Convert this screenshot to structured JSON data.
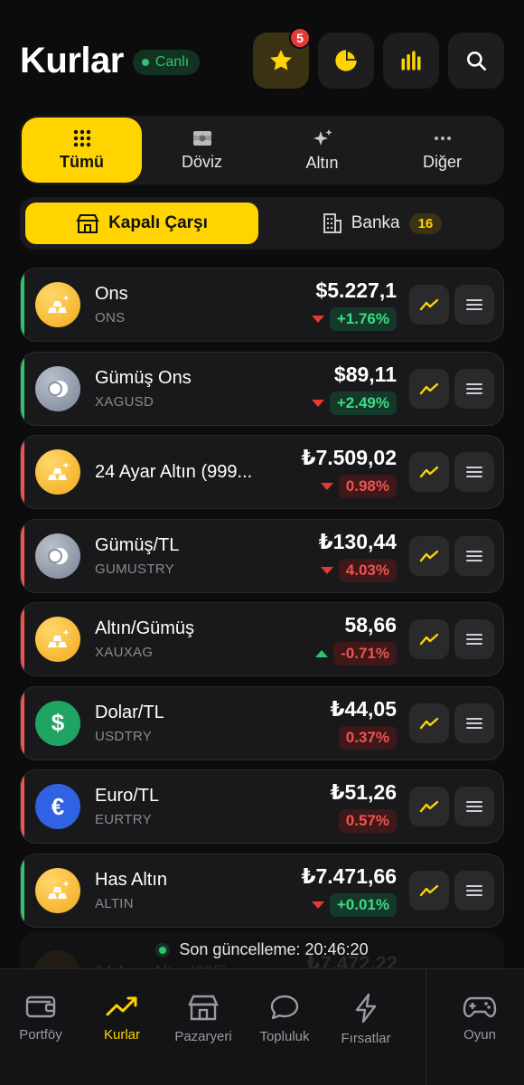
{
  "header": {
    "title": "Kurlar",
    "live_label": "Canlı",
    "favorites_badge": "5"
  },
  "categories": [
    {
      "label": "Tümü",
      "icon": "grid-icon",
      "active": true
    },
    {
      "label": "Döviz",
      "icon": "money-icon",
      "active": false
    },
    {
      "label": "Altın",
      "icon": "sparkle-icon",
      "active": false
    },
    {
      "label": "Diğer",
      "icon": "more-icon",
      "active": false
    }
  ],
  "sources": {
    "kapali_carsi": "Kapalı Çarşı",
    "banka": "Banka",
    "banka_count": "16"
  },
  "rates": [
    {
      "name": "Ons",
      "code": "ONS",
      "price": "$5.227,1",
      "change": "+1.76%",
      "trend": "down",
      "change_dir": "pos",
      "bar": "up",
      "avatar": "gold",
      "icon": "gold-bars-icon"
    },
    {
      "name": "Gümüş Ons",
      "code": "XAGUSD",
      "price": "$89,11",
      "change": "+2.49%",
      "trend": "down",
      "change_dir": "pos",
      "bar": "up",
      "avatar": "silver",
      "icon": "silver-coins-icon"
    },
    {
      "name": "24 Ayar Altın (999...",
      "code": "",
      "price": "₺7.509,02",
      "change": "0.98%",
      "trend": "down",
      "change_dir": "neg",
      "bar": "down",
      "avatar": "gold",
      "icon": "gold-bars-icon"
    },
    {
      "name": "Gümüş/TL",
      "code": "GUMUSTRY",
      "price": "₺130,44",
      "change": "4.03%",
      "trend": "down",
      "change_dir": "neg",
      "bar": "down",
      "avatar": "silver",
      "icon": "silver-coins-icon"
    },
    {
      "name": "Altın/Gümüş",
      "code": "XAUXAG",
      "price": "58,66",
      "change": "-0.71%",
      "trend": "up",
      "change_dir": "neg",
      "bar": "down",
      "avatar": "gold",
      "icon": "gold-bars-icon"
    },
    {
      "name": "Dolar/TL",
      "code": "USDTRY",
      "price": "₺44,05",
      "change": "0.37%",
      "trend": "none",
      "change_dir": "neg",
      "bar": "down",
      "avatar": "green",
      "icon": "dollar-icon",
      "symbol": "$"
    },
    {
      "name": "Euro/TL",
      "code": "EURTRY",
      "price": "₺51,26",
      "change": "0.57%",
      "trend": "none",
      "change_dir": "neg",
      "bar": "down",
      "avatar": "blue",
      "icon": "euro-icon",
      "symbol": "€"
    },
    {
      "name": "Has Altın",
      "code": "ALTIN",
      "price": "₺7.471,66",
      "change": "+0.01%",
      "trend": "down",
      "change_dir": "pos",
      "bar": "up",
      "avatar": "gold",
      "icon": "gold-bars-icon"
    }
  ],
  "ghost_row": {
    "name": "24 Ayar Altın (995)",
    "price": "₺7.472,22"
  },
  "last_update": {
    "label": "Son güncelleme:",
    "time": "20:46:20"
  },
  "nav": [
    {
      "label": "Portföy",
      "icon": "wallet-icon",
      "active": false
    },
    {
      "label": "Kurlar",
      "icon": "trend-icon",
      "active": true
    },
    {
      "label": "Pazaryeri",
      "icon": "store-icon",
      "active": false
    },
    {
      "label": "Topluluk",
      "icon": "chat-icon",
      "active": false
    },
    {
      "label": "Fırsatlar",
      "icon": "bolt-icon",
      "active": false
    },
    {
      "label": "Oyun",
      "icon": "gamepad-icon",
      "active": false
    }
  ],
  "colors": {
    "accent": "#ffd400",
    "positive": "#2fc46b",
    "negative": "#ef5350",
    "background": "#0c0c0d"
  }
}
